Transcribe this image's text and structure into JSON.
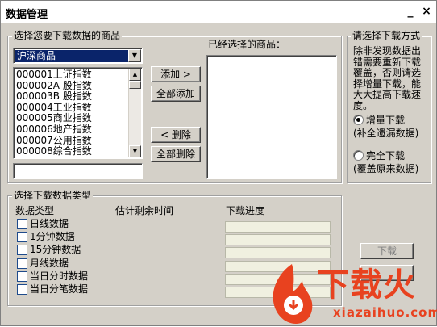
{
  "window": {
    "title": "数据管理",
    "minimize_label": "_",
    "close_label": "×"
  },
  "select_group": {
    "legend": "选择您要下载数据的商品",
    "market_combo": {
      "value": "沪深商品",
      "arrow": "▼"
    },
    "stock_list": [
      "000001上证指数",
      "000002A 股指数",
      "000003B 股指数",
      "000004工业指数",
      "000005商业指数",
      "000006地产指数",
      "000007公用指数",
      "000008综合指数"
    ],
    "search_value": "",
    "scroll_up": "▲",
    "scroll_down": "▼"
  },
  "buttons": {
    "add": "添加 >",
    "add_all": "全部添加",
    "remove": "< 删除",
    "remove_all": "全部删除",
    "download": "下载",
    "hidden_button": ""
  },
  "selected": {
    "label": "已经选择的商品：",
    "items": []
  },
  "mode_group": {
    "legend": "请选择下载方式",
    "description_lines": [
      "除非发现数据出",
      "错需要重新下载",
      "覆盖，否则请选",
      "择增量下载，能",
      "大大提高下载速",
      "度。"
    ],
    "options": [
      {
        "label": "增量下载",
        "note": "(补全遗漏数据)",
        "selected": true
      },
      {
        "label": "完全下载",
        "note": "(覆盖原来数据)",
        "selected": false
      }
    ]
  },
  "types_group": {
    "legend": "选择下载数据类型",
    "col_type": "数据类型",
    "col_time": "估计剩余时间",
    "col_progress": "下载进度",
    "types": [
      {
        "label": "日线数据",
        "checked": false,
        "progress": 0
      },
      {
        "label": "1分钟数据",
        "checked": false,
        "progress": 0
      },
      {
        "label": "15分钟数据",
        "checked": false,
        "progress": 0
      },
      {
        "label": "月线数据",
        "checked": false,
        "progress": 0
      },
      {
        "label": "当日分时数据",
        "checked": false,
        "progress": 0
      },
      {
        "label": "当日分笔数据",
        "checked": false,
        "progress": 0
      }
    ]
  },
  "watermark": {
    "text": "下载火",
    "subtext": "xiazaihuo.com",
    "color": "#e8421f"
  }
}
